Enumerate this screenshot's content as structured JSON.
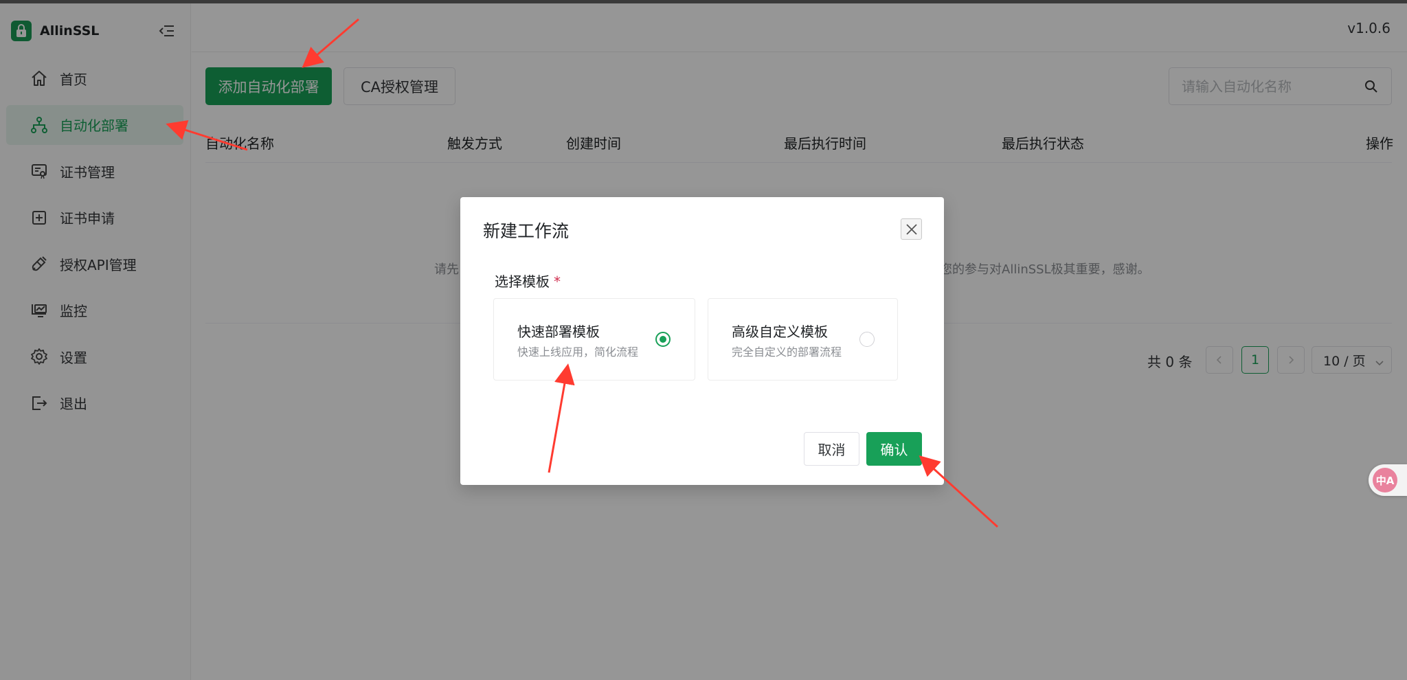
{
  "app": {
    "name": "AllinSSL",
    "version": "v1.0.6"
  },
  "sidebar": {
    "items": [
      {
        "label": "首页",
        "icon": "home-icon",
        "active": false
      },
      {
        "label": "自动化部署",
        "icon": "workflow-icon",
        "active": true
      },
      {
        "label": "证书管理",
        "icon": "certificate-icon",
        "active": false
      },
      {
        "label": "证书申请",
        "icon": "plus-square-icon",
        "active": false
      },
      {
        "label": "授权API管理",
        "icon": "plug-icon",
        "active": false
      },
      {
        "label": "监控",
        "icon": "monitor-icon",
        "active": false
      },
      {
        "label": "设置",
        "icon": "gear-icon",
        "active": false
      },
      {
        "label": "退出",
        "icon": "logout-icon",
        "active": false
      }
    ]
  },
  "toolbar": {
    "add_label": "添加自动化部署",
    "ca_label": "CA授权管理",
    "search_placeholder": "请输入自动化名称"
  },
  "table": {
    "columns": [
      "自动化名称",
      "触发方式",
      "创建时间",
      "最后执行时间",
      "最后执行状态",
      "操作"
    ],
    "empty_left": "请先",
    "empty_right": "您的参与对AllinSSL极其重要，感谢。"
  },
  "pagination": {
    "total": "共 0 条",
    "current_page": "1",
    "page_size": "10 / 页"
  },
  "modal": {
    "title": "新建工作流",
    "field_label": "选择模板",
    "required_mark": "*",
    "templates": [
      {
        "title": "快速部署模板",
        "desc": "快速上线应用，简化流程",
        "selected": true
      },
      {
        "title": "高级自定义模板",
        "desc": "完全自定义的部署流程",
        "selected": false
      }
    ],
    "cancel_label": "取消",
    "confirm_label": "确认"
  },
  "translate_widget": {
    "label": "中A"
  },
  "colors": {
    "primary": "#18a058",
    "annotation": "#ff3b30",
    "required": "#d03050"
  }
}
